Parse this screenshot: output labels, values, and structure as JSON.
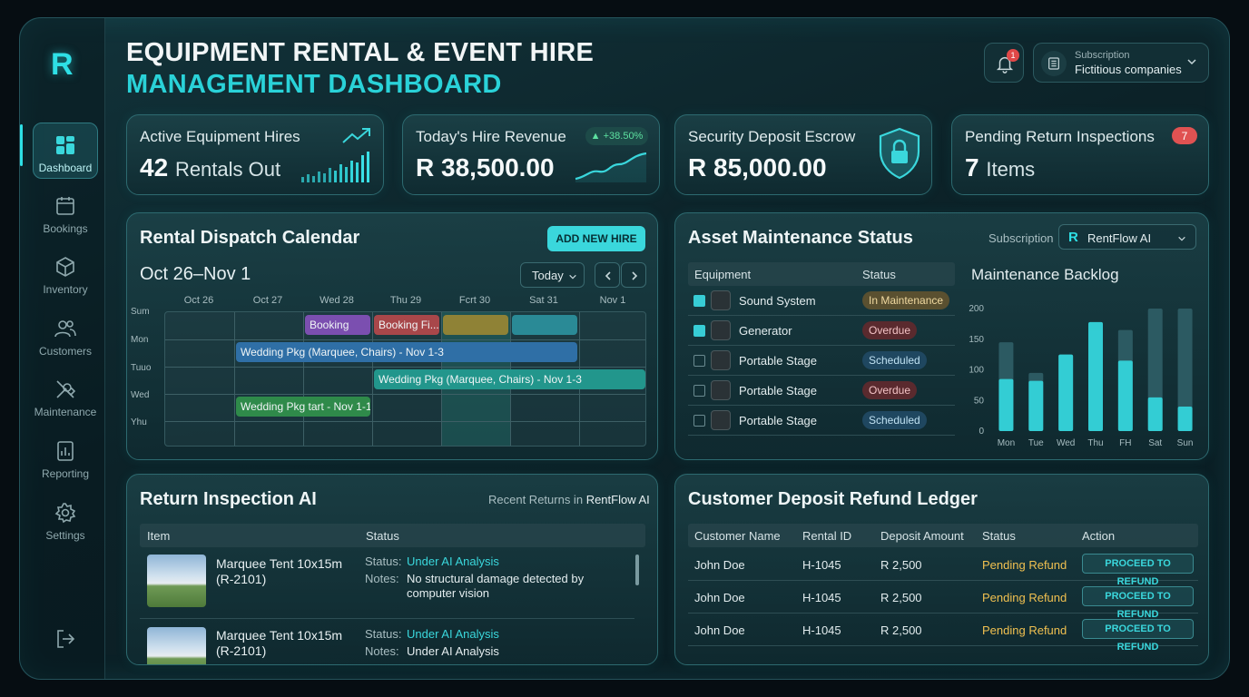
{
  "app": {
    "logo_letter": "R",
    "title_line1": "EQUIPMENT RENTAL & EVENT HIRE",
    "title_line2": "MANAGEMENT DASHBOARD"
  },
  "sidebar": {
    "items": [
      {
        "label": "Dashboard",
        "icon": "dashboard-icon",
        "active": true
      },
      {
        "label": "Bookings",
        "icon": "calendar-icon"
      },
      {
        "label": "Inventory",
        "icon": "box-icon"
      },
      {
        "label": "Customers",
        "icon": "users-icon"
      },
      {
        "label": "Maintenance",
        "icon": "tools-icon"
      },
      {
        "label": "Reporting",
        "icon": "report-icon"
      },
      {
        "label": "Settings",
        "icon": "gear-icon"
      }
    ],
    "logout_icon": "logout-icon"
  },
  "header": {
    "notification_count": "1",
    "subscription_label": "Subscription",
    "subscription_value": "Fictitious companies"
  },
  "kpis": {
    "active_hires": {
      "label": "Active Equipment Hires",
      "value": "42",
      "unit": "Rentals Out"
    },
    "revenue": {
      "label": "Today's Hire Revenue",
      "value": "R 38,500.00",
      "change": "+38.50%"
    },
    "escrow": {
      "label": "Security Deposit Escrow",
      "value": "R 85,000.00"
    },
    "inspections": {
      "label": "Pending Return Inspections",
      "value": "7",
      "unit": "Items",
      "badge": "7"
    }
  },
  "calendar": {
    "title": "Rental Dispatch Calendar",
    "add_button": "ADD NEW HIRE",
    "range": "Oct 26–Nov 1",
    "today_button": "Today",
    "columns": [
      "Oct 26",
      "Oct 27",
      "Wed 28",
      "Thu 29",
      "Fcrt 30",
      "Sat 31",
      "Nov 1"
    ],
    "rows": [
      "Sum",
      "Mon",
      "Tuuo",
      "Wed",
      "Yhu"
    ],
    "events": [
      {
        "label": "Booking",
        "color": "#7b4fb0"
      },
      {
        "label": "Booking Fi...",
        "color": "#a8474a"
      },
      {
        "label": "",
        "color": "#8f8236"
      },
      {
        "label": "",
        "color": "#2a8a96"
      },
      {
        "label": "Wedding Pkg (Marquee, Chairs) - Nov 1-3",
        "color": "#2f6fa6"
      },
      {
        "label": "Wedding Pkg (Marquee, Chairs) - Nov 1-3",
        "color": "#22968c"
      },
      {
        "label": "Wedding Pkg tart - Nov 1-1",
        "color": "#2f8a4a"
      }
    ]
  },
  "maintenance": {
    "title": "Asset Maintenance Status",
    "subscription_label": "Subscription",
    "subscription_value": "RentFlow AI",
    "col_equipment": "Equipment",
    "col_status": "Status",
    "rows": [
      {
        "name": "Sound System",
        "status": "In Maintenance",
        "checked": true
      },
      {
        "name": "Generator",
        "status": "Overdue",
        "checked": true
      },
      {
        "name": "Portable Stage",
        "status": "Scheduled",
        "checked": false
      },
      {
        "name": "Portable Stage",
        "status": "Overdue",
        "checked": false
      },
      {
        "name": "Portable Stage",
        "status": "Scheduled",
        "checked": false
      }
    ]
  },
  "chart_data": {
    "type": "bar",
    "title": "Maintenance Backlog",
    "categories": [
      "Mon",
      "Tue",
      "Wed",
      "Thu",
      "FH",
      "Sat",
      "Sun"
    ],
    "series": [
      {
        "values": [
          145,
          95,
          125,
          165,
          165,
          200,
          200
        ],
        "color": "#2c5a62"
      },
      {
        "values": [
          85,
          82,
          125,
          178,
          115,
          55,
          40
        ],
        "color": "#34d4da"
      }
    ],
    "yticks": [
      200,
      150,
      100,
      50,
      0
    ],
    "ylim": [
      0,
      200
    ],
    "grid": false
  },
  "inspection": {
    "title": "Return Inspection AI",
    "subtitle_prefix": "Recent Returns in",
    "subtitle_brand": "RentFlow AI",
    "col_item": "Item",
    "col_status": "Status",
    "items": [
      {
        "name": "Marquee Tent 10x15m",
        "code": "(R-2101)",
        "status_label": "Status:",
        "status": "Under AI Analysis",
        "notes_label": "Notes:",
        "notes": "No structural damage detected by computer vision"
      },
      {
        "name": "Marquee Tent 10x15m",
        "code": "(R-2101)",
        "status_label": "Status:",
        "status": "Under AI Analysis",
        "notes_label": "Notes:",
        "notes": "Under AI Analysis"
      }
    ]
  },
  "ledger": {
    "title": "Customer Deposit Refund Ledger",
    "columns": [
      "Customer Name",
      "Rental ID",
      "Deposit Amount",
      "Status",
      "Action"
    ],
    "rows": [
      {
        "name": "John Doe",
        "id": "H-1045",
        "amount": "R 2,500",
        "status": "Pending Refund",
        "action": "PROCEED TO REFUND"
      },
      {
        "name": "John Doe",
        "id": "H-1045",
        "amount": "R 2,500",
        "status": "Pending Refund",
        "action": "PROCEED TO REFUND"
      },
      {
        "name": "John Doe",
        "id": "H-1045",
        "amount": "R 2,500",
        "status": "Pending Refund",
        "action": "PROCEED TO REFUND"
      }
    ]
  }
}
